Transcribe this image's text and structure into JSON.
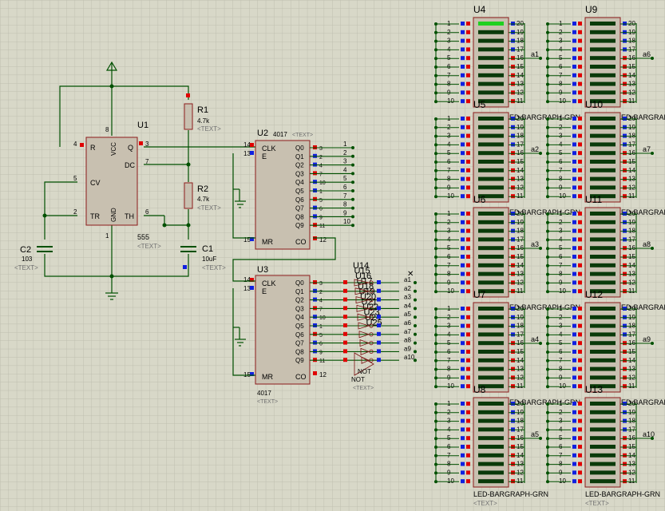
{
  "colors": {
    "background": "#d8d8c8",
    "grid": "#bfbfb0",
    "wire": "#005000",
    "part_body": "#c8c0b0",
    "part_outline": "#8b1a1a",
    "pin_red": "#e00000",
    "pin_blue": "#1020e0",
    "led_off": "#0a3a0a",
    "led_on": "#20d020",
    "placeholder_text": "#707070"
  },
  "timer": {
    "ref": "U1",
    "part": "555",
    "pins": {
      "r": "R",
      "vcc": "VCC",
      "q": "Q",
      "dc": "DC",
      "cv": "CV",
      "tr": "TR",
      "gnd": "GND",
      "th": "TH"
    },
    "pin_numbers": {
      "r": "4",
      "vcc": "8",
      "q": "3",
      "dc": "7",
      "cv": "5",
      "tr": "2",
      "gnd": "1",
      "th": "6"
    },
    "text_placeholder": "<TEXT>"
  },
  "resistors": [
    {
      "ref": "R1",
      "value": "4.7k",
      "text": "<TEXT>"
    },
    {
      "ref": "R2",
      "value": "4.7k",
      "text": "<TEXT>"
    }
  ],
  "capacitors": [
    {
      "ref": "C1",
      "value": "10uF",
      "text": "<TEXT>"
    },
    {
      "ref": "C2",
      "value": "103",
      "text": "<TEXT>"
    }
  ],
  "counters": [
    {
      "ref": "U2",
      "part": "4017",
      "text": "<TEXT>",
      "clk": "CLK",
      "e": "E",
      "mr": "MR",
      "co": "CO",
      "clk_pin": "14",
      "e_pin": "13",
      "mr_pin": "15",
      "co_pin": "12",
      "outputs": [
        "Q0",
        "Q1",
        "Q2",
        "Q3",
        "Q4",
        "Q5",
        "Q6",
        "Q7",
        "Q8",
        "Q9"
      ],
      "output_pins": [
        "3",
        "2",
        "4",
        "7",
        "10",
        "1",
        "5",
        "6",
        "9",
        "11"
      ],
      "net_labels": [
        "1",
        "2",
        "3",
        "4",
        "5",
        "6",
        "7",
        "8",
        "9",
        "10"
      ]
    },
    {
      "ref": "U3",
      "part": "4017",
      "text": "<TEXT>",
      "clk": "CLK",
      "e": "E",
      "mr": "MR",
      "co": "CO",
      "clk_pin": "14",
      "e_pin": "13",
      "mr_pin": "15",
      "co_pin": "12",
      "outputs": [
        "Q0",
        "Q1",
        "Q2",
        "Q3",
        "Q4",
        "Q5",
        "Q6",
        "Q7",
        "Q8",
        "Q9"
      ],
      "output_pins": [
        "3",
        "2",
        "4",
        "7",
        "10",
        "1",
        "5",
        "6",
        "9",
        "11"
      ],
      "net_labels": [
        "a1",
        "a2",
        "a3",
        "a4",
        "a5",
        "a6",
        "a7",
        "a8",
        "a9",
        "a10"
      ]
    }
  ],
  "inverters": {
    "refs": [
      "U14",
      "U15",
      "U16",
      "U17",
      "U18",
      "U19",
      "U20",
      "U21",
      "U22",
      "U23",
      "U24",
      "U25"
    ],
    "part": "NOT",
    "text": "<TEXT>"
  },
  "bargraphs": {
    "part": "LED-BARGRAPH-GRN",
    "text": "<TEXT>",
    "left_pins": [
      "1",
      "2",
      "3",
      "4",
      "5",
      "6",
      "7",
      "8",
      "9",
      "10"
    ],
    "right_pins": [
      "20",
      "19",
      "18",
      "17",
      "16",
      "15",
      "14",
      "13",
      "12",
      "11"
    ],
    "units": [
      {
        "ref": "U4",
        "net": "a1",
        "lit": [
          0
        ]
      },
      {
        "ref": "U5",
        "net": "a2",
        "lit": []
      },
      {
        "ref": "U6",
        "net": "a3",
        "lit": []
      },
      {
        "ref": "U7",
        "net": "a4",
        "lit": []
      },
      {
        "ref": "U8",
        "net": "a5",
        "lit": []
      },
      {
        "ref": "U9",
        "net": "a6",
        "lit": []
      },
      {
        "ref": "U10",
        "net": "a7",
        "lit": []
      },
      {
        "ref": "U11",
        "net": "a8",
        "lit": []
      },
      {
        "ref": "U12",
        "net": "a9",
        "lit": []
      },
      {
        "ref": "U13",
        "net": "a10",
        "lit": []
      }
    ]
  }
}
